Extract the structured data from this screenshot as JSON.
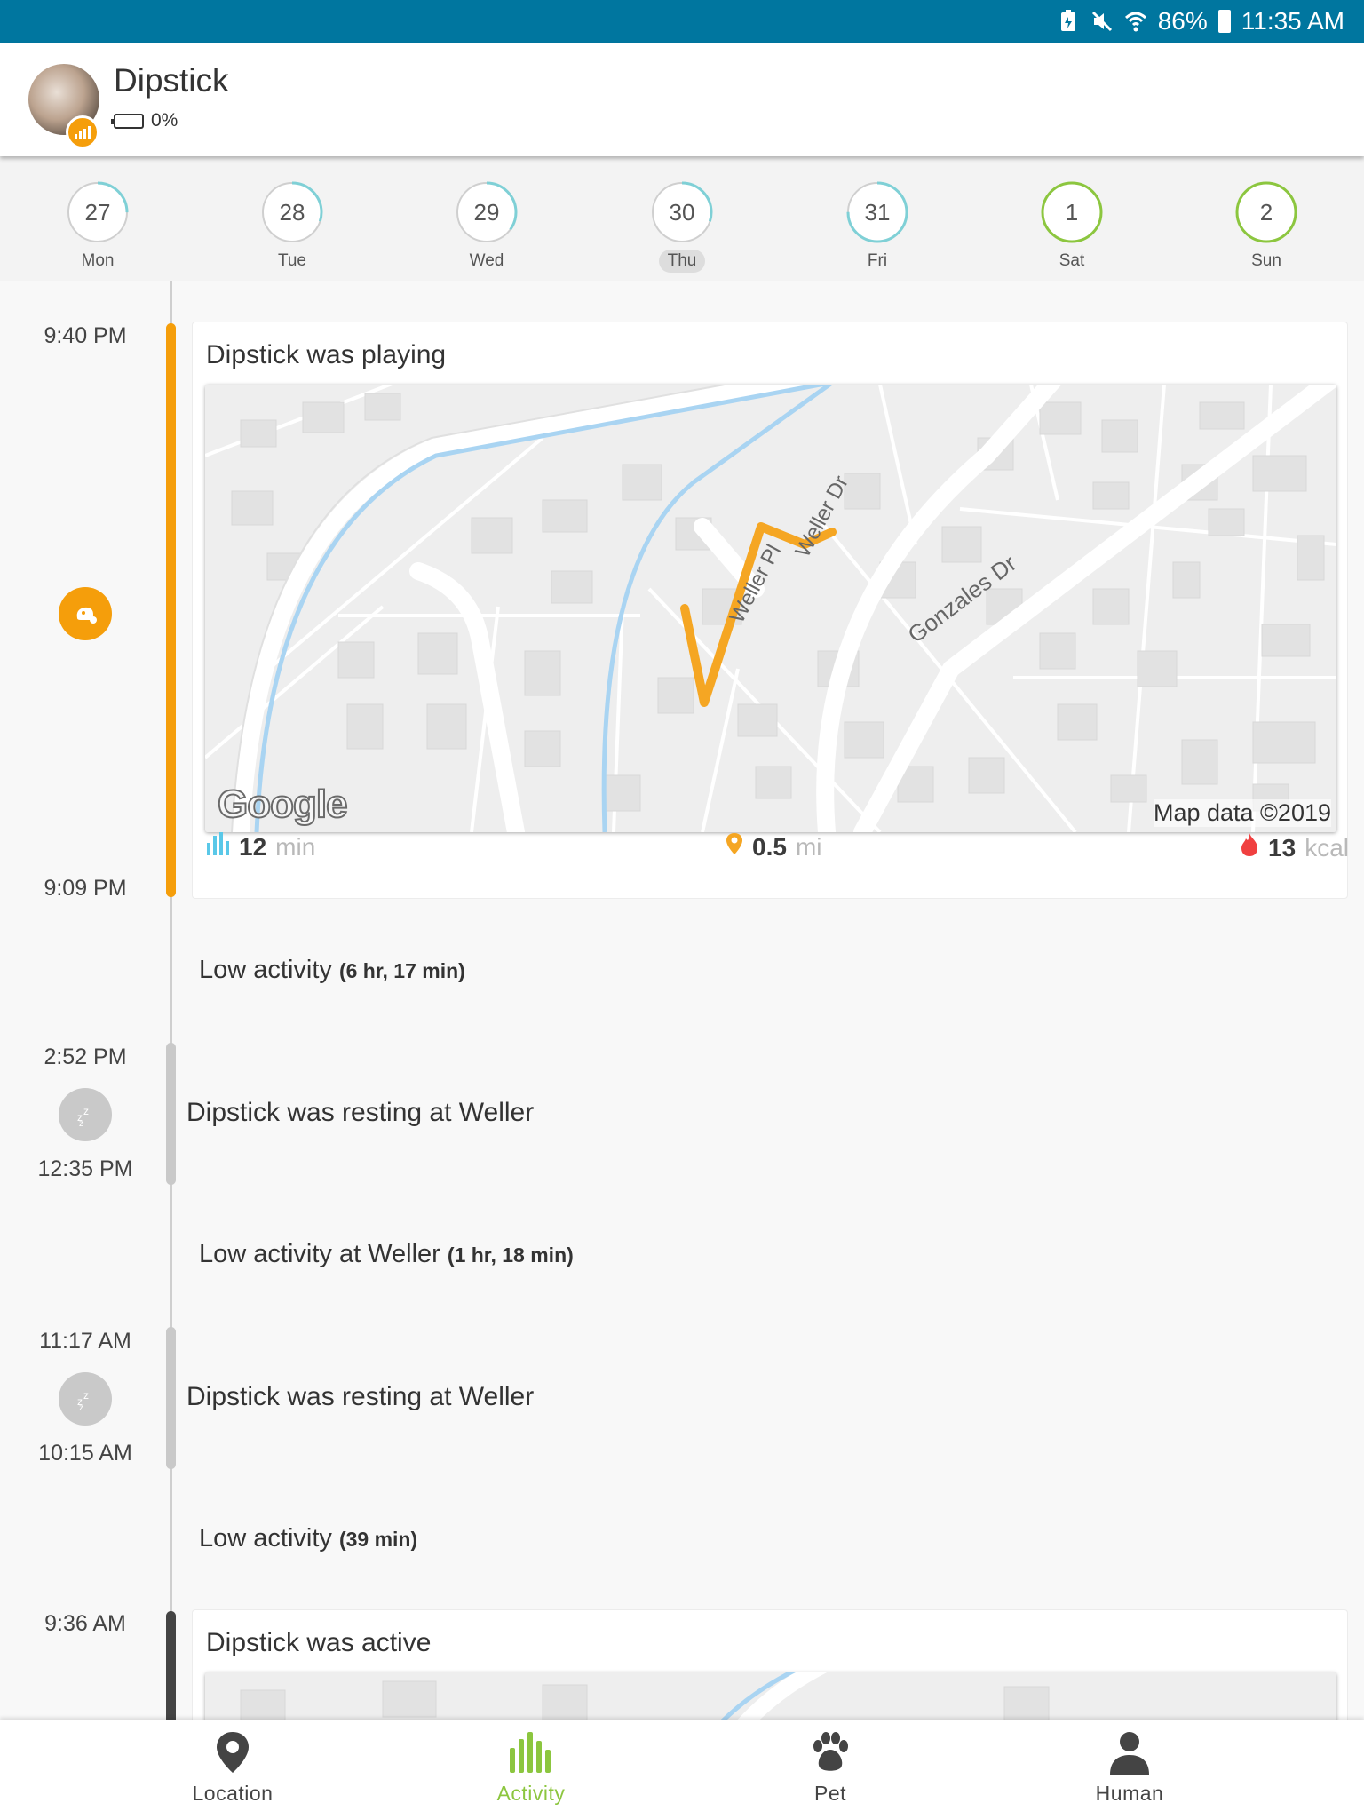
{
  "status_bar": {
    "battery": "86%",
    "time": "11:35 AM"
  },
  "header": {
    "pet_name": "Dipstick",
    "battery": "0%"
  },
  "week": {
    "days": [
      {
        "num": "27",
        "label": "Mon",
        "progress": 0.25,
        "selected": false
      },
      {
        "num": "28",
        "label": "Tue",
        "progress": 0.3,
        "selected": false
      },
      {
        "num": "29",
        "label": "Wed",
        "progress": 0.35,
        "selected": false
      },
      {
        "num": "30",
        "label": "Thu",
        "progress": 0.3,
        "selected": true
      },
      {
        "num": "31",
        "label": "Fri",
        "progress": 0.75,
        "selected": false
      },
      {
        "num": "1",
        "label": "Sat",
        "progress": 1.0,
        "selected": false
      },
      {
        "num": "2",
        "label": "Sun",
        "progress": 1.0,
        "selected": false
      }
    ]
  },
  "timeline": {
    "playing": {
      "start_time": "9:40 PM",
      "end_time": "9:09 PM",
      "title": "Dipstick was playing",
      "map": {
        "streets": [
          "Weller Pl",
          "Weller Dr",
          "Gonzales Dr"
        ],
        "credit": "Map data ©2019",
        "logo": "Google"
      },
      "duration_value": "12",
      "duration_unit": "min",
      "distance_value": "0.5",
      "distance_unit": "mi",
      "calories_value": "13",
      "calories_unit": "kcal"
    },
    "low_activity_1": {
      "label": "Low activity",
      "detail": "(6 hr, 17 min)"
    },
    "resting_1": {
      "start_time": "2:52 PM",
      "end_time": "12:35 PM",
      "title": "Dipstick was resting at Weller"
    },
    "low_activity_2": {
      "label": "Low activity at Weller",
      "detail": "(1 hr, 18 min)"
    },
    "resting_2": {
      "start_time": "11:17 AM",
      "end_time": "10:15 AM",
      "title": "Dipstick was resting at Weller"
    },
    "low_activity_3": {
      "label": "Low activity",
      "detail": "(39 min)"
    },
    "active": {
      "start_time": "9:36 AM",
      "title": "Dipstick was active"
    }
  },
  "nav": {
    "items": [
      {
        "label": "Location",
        "icon": "location-pin-icon",
        "active": false
      },
      {
        "label": "Activity",
        "icon": "activity-bars-icon",
        "active": true
      },
      {
        "label": "Pet",
        "icon": "paw-icon",
        "active": false
      },
      {
        "label": "Human",
        "icon": "person-icon",
        "active": false
      }
    ]
  },
  "colors": {
    "status_bar": "#00769f",
    "accent_orange": "#f59e0b",
    "accent_green": "#8cc63f",
    "ring_teal": "#7fd0d6",
    "resting_gray": "#c9c9c9",
    "active_dark": "#444444"
  }
}
